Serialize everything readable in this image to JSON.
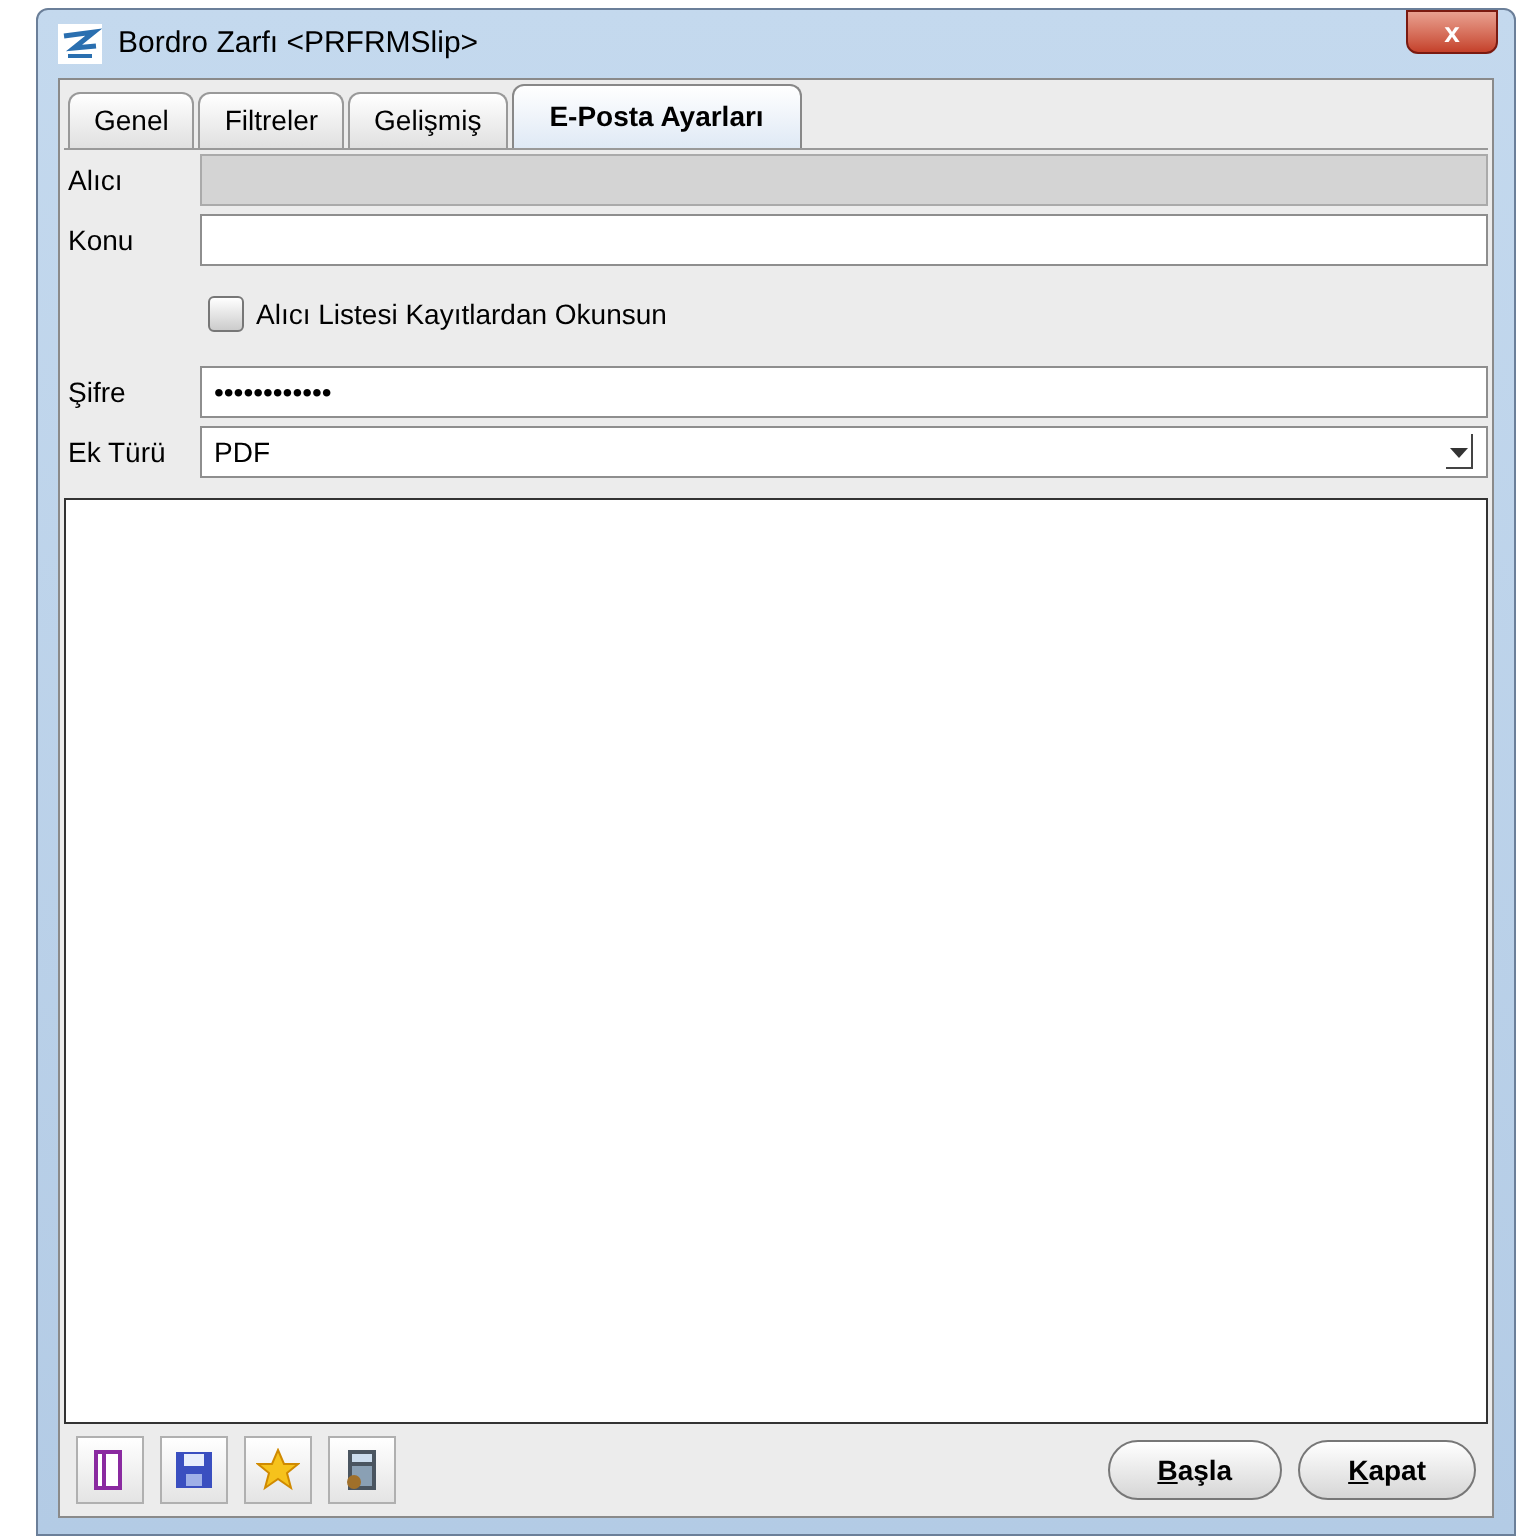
{
  "window": {
    "title": "Bordro Zarfı <PRFRMSlip>",
    "close": "x"
  },
  "tabs": [
    {
      "label": "Genel",
      "selected": false
    },
    {
      "label": "Filtreler",
      "selected": false
    },
    {
      "label": "Gelişmiş",
      "selected": false
    },
    {
      "label": "E-Posta Ayarları",
      "selected": true
    }
  ],
  "recipient": {
    "label": "Alıcı",
    "disabled": true
  },
  "subject": {
    "label": "Konu",
    "disabled": false
  },
  "recipient_list_checkbox": {
    "label": "Alıcı Listesi Kayıtlardan Okunsun",
    "checked": false
  },
  "password": {
    "label": "Şifre",
    "value": "••••••••••••"
  },
  "attachment_type": {
    "label": "Ek Türü",
    "value": "PDF"
  },
  "toolbar": [
    {
      "kind": "page"
    },
    {
      "kind": "save"
    },
    {
      "kind": "star"
    },
    {
      "kind": "calculator"
    }
  ],
  "buttons": [
    {
      "label": "Başla",
      "mnemonic_underlined": true
    },
    {
      "label": "Kapat",
      "mnemonic_underlined": true
    }
  ]
}
